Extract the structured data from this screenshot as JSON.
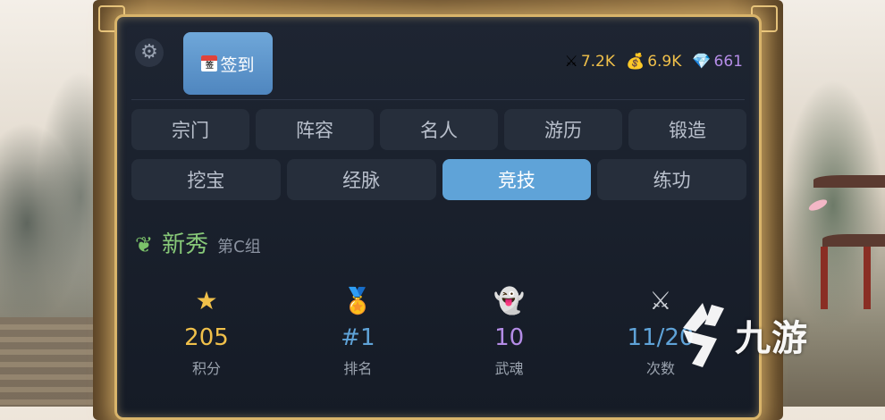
{
  "topbar": {
    "settings_icon": "gear-icon",
    "checkin_label": "签到",
    "checkin_icon_text": "签"
  },
  "resources": [
    {
      "icon": "crossed-swords-icon",
      "value": "7.2K",
      "color": "#f0c04a"
    },
    {
      "icon": "money-bag-icon",
      "value": "6.9K",
      "color": "#f0c04a"
    },
    {
      "icon": "diamond-icon",
      "value": "661",
      "color": "#b48ce6"
    }
  ],
  "tabs_row1": [
    "宗门",
    "阵容",
    "名人",
    "游历",
    "锻造"
  ],
  "tabs_row2": [
    "挖宝",
    "经脉",
    "竞技",
    "练功"
  ],
  "active_tab": "竞技",
  "rank": {
    "title": "新秀",
    "group": "第C组"
  },
  "stats": [
    {
      "icon": "star-icon",
      "value": "205",
      "label": "积分",
      "color": "#f0c04a"
    },
    {
      "icon": "medal-icon",
      "value": "#1",
      "label": "排名",
      "color": "#5fa3d8"
    },
    {
      "icon": "ghost-icon",
      "value": "10",
      "label": "武魂",
      "color": "#b48ce6"
    },
    {
      "icon": "crossed-swords-icon",
      "value": "11/20",
      "label": "次数",
      "color": "#5fa3d8"
    }
  ],
  "watermark": {
    "text": "九游"
  },
  "colors": {
    "panel": "#1a202b",
    "tab": "#262e3b",
    "active_tab": "#5fa3d8",
    "frame_gold": "#d9b46a"
  }
}
